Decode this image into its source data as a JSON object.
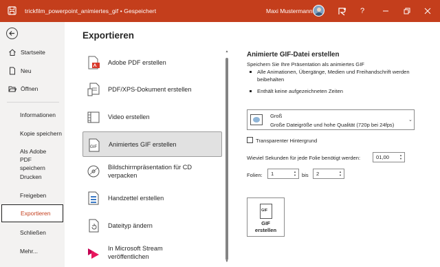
{
  "titlebar": {
    "file_name": "trickfilm_powerpoint_animiertes_gif",
    "separator": "•",
    "status": "Gespeichert",
    "user_name": "Maxi Mustermann",
    "help_label": "?",
    "colors": {
      "accent": "#c43e1c"
    }
  },
  "nav": {
    "items_top": [
      {
        "label": "Startseite",
        "icon": "home-icon"
      },
      {
        "label": "Neu",
        "icon": "new-document-icon"
      },
      {
        "label": "Öffnen",
        "icon": "folder-open-icon"
      }
    ],
    "items": [
      "Informationen",
      "Kopie speichern",
      "Als Adobe PDF speichern",
      "Drucken",
      "Freigeben",
      "Exportieren",
      "Schließen",
      "Mehr..."
    ],
    "selected": "Exportieren"
  },
  "main": {
    "title": "Exportieren",
    "export_options": [
      {
        "label": "Adobe PDF erstellen",
        "icon": "adobe-pdf-icon"
      },
      {
        "label": "PDF/XPS-Dokument erstellen",
        "icon": "pdf-xps-icon"
      },
      {
        "label": "Video erstellen",
        "icon": "video-icon"
      },
      {
        "label": "Animiertes GIF erstellen",
        "icon": "gif-icon",
        "selected": true
      },
      {
        "label": "Bildschirmpräsentation für CD verpacken",
        "icon": "cd-icon"
      },
      {
        "label": "Handzettel erstellen",
        "icon": "handout-icon"
      },
      {
        "label": "Dateityp ändern",
        "icon": "change-filetype-icon"
      },
      {
        "label": "In Microsoft Stream veröffentlichen",
        "icon": "stream-icon"
      }
    ]
  },
  "panel": {
    "title": "Animierte GIF-Datei erstellen",
    "description": "Speichern Sie Ihre Präsentation als animiertes GIF",
    "bullets": [
      "Alle Animationen, Übergänge, Medien und Freihandschrift werden beibehalten",
      "Enthält keine aufgezeichneten Zeiten"
    ],
    "quality": {
      "title": "Groß",
      "subtitle": "Große Dateigröße und hohe Qualität (720p bei 24fps)"
    },
    "transparent_bg_label": "Transparenter Hintergrund",
    "transparent_bg_checked": false,
    "seconds_label": "Wieviel Sekunden für jede Folie benötigt werden:",
    "seconds_value": "01,00",
    "slides_label": "Folien:",
    "slides_from": "1",
    "slides_to_label": "bis",
    "slides_to": "2",
    "create_button": {
      "line1": "GIF",
      "line2": "erstellen"
    }
  }
}
